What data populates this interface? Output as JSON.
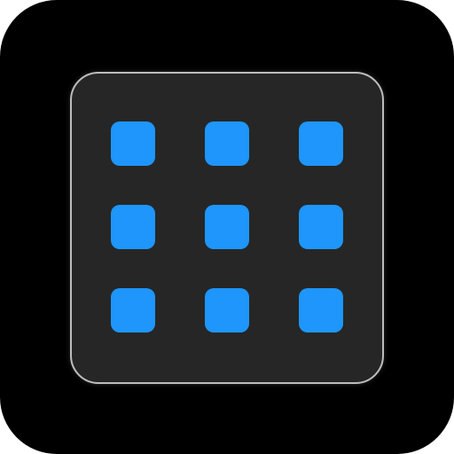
{
  "icon": {
    "symbol": "grid-3x3-icon",
    "rows": 3,
    "columns": 3,
    "colors": {
      "background": "#000000",
      "panel": "#262626",
      "panel_border": "#bdbdbd",
      "dot": "#1e96fc"
    }
  }
}
